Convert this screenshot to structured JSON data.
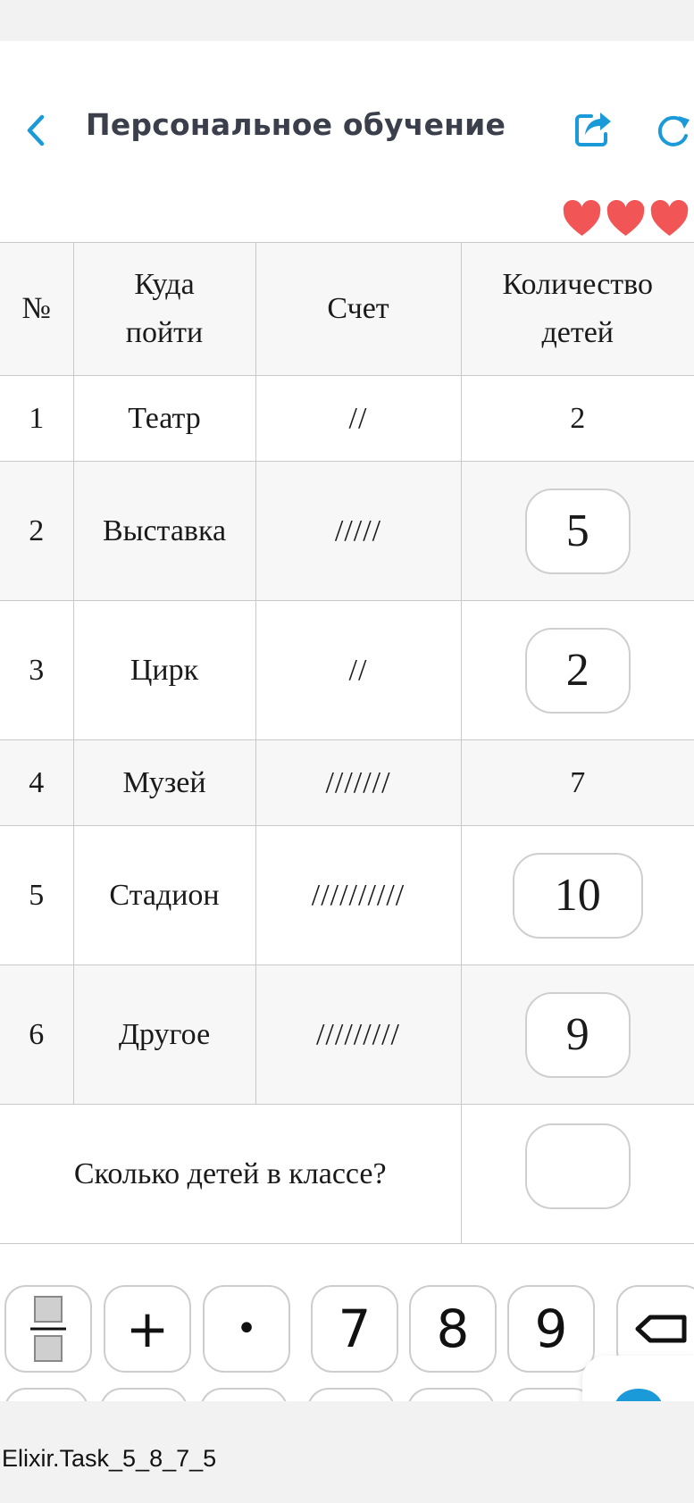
{
  "header": {
    "title": "Персональное обучение",
    "back_icon": "chevron-left-icon",
    "share_icon": "share-icon",
    "refresh_icon": "refresh-icon",
    "accent_color": "#1a9ad8"
  },
  "lives": {
    "count": 3,
    "icon": "heart-icon",
    "color": "#f25555"
  },
  "table": {
    "headers": [
      "№",
      "Куда пойти",
      "Счет",
      "Количество детей"
    ],
    "rows": [
      {
        "num": "1",
        "place": "Театр",
        "tally": "//",
        "count": "2",
        "editable": false
      },
      {
        "num": "2",
        "place": "Выставка",
        "tally": "/////",
        "count": "5",
        "editable": true
      },
      {
        "num": "3",
        "place": "Цирк",
        "tally": "//",
        "count": "2",
        "editable": true
      },
      {
        "num": "4",
        "place": "Музей",
        "tally": "///////",
        "count": "7",
        "editable": false
      },
      {
        "num": "5",
        "place": "Стадион",
        "tally": "//////////",
        "count": "10",
        "editable": true
      },
      {
        "num": "6",
        "place": "Другое",
        "tally": "/////////",
        "count": "9",
        "editable": true
      }
    ],
    "question": "Сколько детей в классе?",
    "answer": ""
  },
  "keyboard": {
    "row1": [
      {
        "id": "fraction",
        "label": "",
        "icon": "fraction-icon"
      },
      {
        "id": "plus",
        "label": "+"
      },
      {
        "id": "dot",
        "label": "•"
      },
      {
        "id": "seven",
        "label": "7"
      },
      {
        "id": "eight",
        "label": "8"
      },
      {
        "id": "nine",
        "label": "9"
      },
      {
        "id": "backspace",
        "label": "",
        "icon": "backspace-icon"
      }
    ]
  },
  "chat": {
    "icon": "chat-bubble-icon",
    "color": "#1a9ad8"
  },
  "footer": {
    "task_id": "Elixir.Task_5_8_7_5"
  }
}
